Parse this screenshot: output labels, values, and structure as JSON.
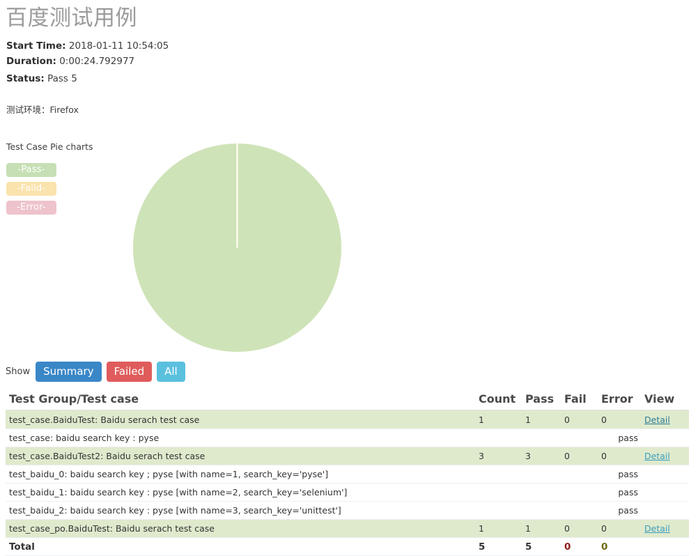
{
  "report": {
    "title": "百度测试用例",
    "start_time_label": "Start Time:",
    "start_time_value": "2018-01-11 10:54:05",
    "duration_label": "Duration:",
    "duration_value": "0:00:24.792977",
    "status_label": "Status:",
    "status_value": "Pass 5",
    "environment_line": "测试环境：Firefox"
  },
  "pie": {
    "caption": "Test Case Pie charts",
    "legend": [
      {
        "label": "-Pass-",
        "color": "#c6dfb4"
      },
      {
        "label": "-Faild-",
        "color": "#fae3ac"
      },
      {
        "label": "-Error-",
        "color": "#eec3cb"
      }
    ]
  },
  "chart_data": {
    "type": "pie",
    "title": "Test Case Pie charts",
    "categories": [
      "Pass",
      "Faild",
      "Error"
    ],
    "values": [
      5,
      0,
      0
    ],
    "colors": [
      "#cfe3b8",
      "#fae3ac",
      "#eec3cb"
    ],
    "total": 5,
    "legend_position": "left",
    "start_angle_deg": 90,
    "separator_color": "#fdfdf5"
  },
  "filters": {
    "show_label": "Show",
    "buttons": [
      {
        "label": "Summary",
        "color": "#3a87c8"
      },
      {
        "label": "Failed",
        "color": "#e05c5c"
      },
      {
        "label": "All",
        "color": "#5bc0de"
      }
    ]
  },
  "table": {
    "headers": [
      "Test Group/Test case",
      "Count",
      "Pass",
      "Fail",
      "Error",
      "View"
    ],
    "rows": [
      {
        "kind": "group",
        "name": "test_case.BaiduTest: Baidu serach test case",
        "count": "1",
        "pass": "1",
        "fail": "0",
        "error": "0",
        "view": "Detail"
      },
      {
        "kind": "case",
        "name": "test_case: baidu search key : pyse",
        "verdict": "pass"
      },
      {
        "kind": "group",
        "name": "test_case.BaiduTest2: Baidu serach test case",
        "count": "3",
        "pass": "3",
        "fail": "0",
        "error": "0",
        "view": "Detail"
      },
      {
        "kind": "case",
        "name": "test_baidu_0: baidu search key ; pyse [with name=1, search_key='pyse']",
        "verdict": "pass"
      },
      {
        "kind": "case",
        "name": "test_baidu_1: baidu search key : pyse [with name=2, search_key='selenium']",
        "verdict": "pass"
      },
      {
        "kind": "case",
        "name": "test_baidu_2: baidu search key : pyse [with name=3, search_key='unittest']",
        "verdict": "pass"
      },
      {
        "kind": "group",
        "name": "test_case_po.BaiduTest: Baidu serach test case",
        "count": "1",
        "pass": "1",
        "fail": "0",
        "error": "0",
        "view": "Detail"
      }
    ],
    "total": {
      "label": "Total",
      "count": "5",
      "pass": "5",
      "fail": "0",
      "error": "0",
      "view": ""
    }
  }
}
